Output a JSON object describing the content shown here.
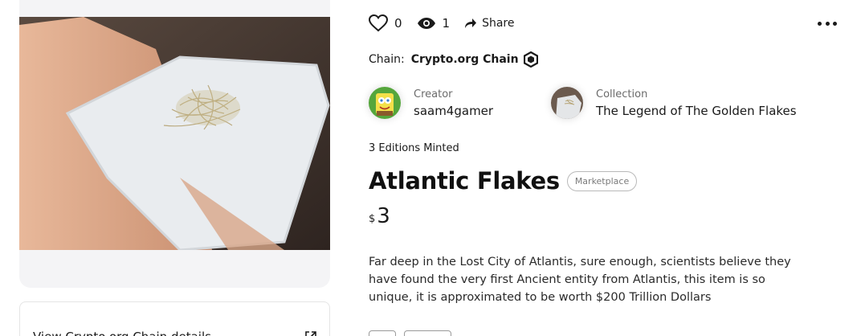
{
  "stats": {
    "likes_icon": "heart-icon",
    "likes_count": "0",
    "views_icon": "eye-icon",
    "views_count": "1",
    "share_icon": "share-arrow-icon",
    "share_label": "Share",
    "more_icon": "more-horizontal-icon"
  },
  "chain": {
    "label": "Chain:",
    "name": "Crypto.org Chain",
    "icon": "crypto-org-chain-icon"
  },
  "creator": {
    "role": "Creator",
    "name": "saam4gamer"
  },
  "collection": {
    "role": "Collection",
    "name": "The Legend of The Golden Flakes"
  },
  "editions": "3 Editions Minted",
  "nft": {
    "title": "Atlantic Flakes",
    "badge": "Marketplace",
    "price_currency": "$",
    "price_value": "3",
    "description": "Far deep in the Lost City of Atlantis, sure enough, scientists believe they have found the very first Ancient entity from Atlantis, this item is so unique, it is approximated to be worth $200 Trillion Dollars"
  },
  "details": {
    "link_label": "View Crypto.org Chain details",
    "icon": "external-link-icon"
  },
  "colors": {
    "text": "#1a1a1a",
    "muted": "#6b6b6b",
    "card_bg": "#f4f4f6",
    "border": "#e5e5e5"
  }
}
